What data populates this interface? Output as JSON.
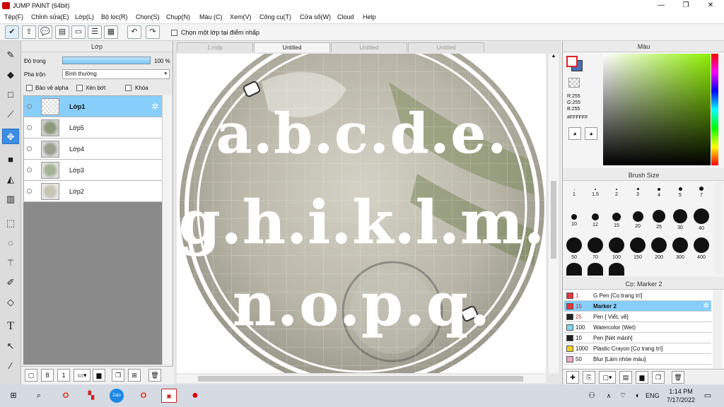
{
  "window": {
    "title": "JUMP PAINT (64bit)"
  },
  "menu": [
    "Tệp(F)",
    "Chỉnh sửa(E)",
    "Lớp(L)",
    "Bộ lọc(R)",
    "Chọn(S)",
    "Chụp(N)",
    "Màu (C)",
    "Xem(V)",
    "Công cụ(T)",
    "Cửa sổ(W)",
    "Cloud",
    "Help"
  ],
  "toolbar": {
    "refer_label": "Chọn một lớp tại điểm nhấp"
  },
  "layer_panel": {
    "title": "Lớp",
    "opacity_label": "Độ trong",
    "opacity_value": "100 %",
    "blend_label": "Pha trộn",
    "blend_value": "Bình thường",
    "alpha_label": "Bảo vệ alpha",
    "clip_label": "Xén bớt",
    "lock_label": "Khóa",
    "layers": [
      {
        "name": "Lớp1"
      },
      {
        "name": "Lớp5"
      },
      {
        "name": "Lớp4"
      },
      {
        "name": "Lớp3"
      },
      {
        "name": "Lớp2"
      }
    ]
  },
  "canvas": {
    "tabs": [
      "1.mdp",
      "Untitled",
      "Untitled",
      "Untitled"
    ],
    "art_lines": [
      "a.b.c.d.e.",
      "g.h.i.k.l.m.",
      "n.o.p.q."
    ]
  },
  "color_panel": {
    "title": "Màu",
    "r": "R:255",
    "g": "G:255",
    "b": "B:255",
    "hex": "#FFFFFF"
  },
  "brush_size": {
    "title": "Brush Size",
    "sizes": [
      "1",
      "1.5",
      "2",
      "3",
      "4",
      "5",
      "7",
      "10",
      "12",
      "15",
      "20",
      "25",
      "30",
      "40",
      "50",
      "70",
      "100",
      "150",
      "200",
      "300",
      "400"
    ]
  },
  "brush_panel": {
    "title": "Cọ: Marker 2",
    "brushes": [
      {
        "size": "1",
        "name": "G Pen [Cọ trang trí]",
        "color": "#e8343b"
      },
      {
        "size": "15",
        "name": "Marker 2",
        "color": "#e8343b"
      },
      {
        "size": "25",
        "name": "Pen [ Viết, vẽ]",
        "color": "#222222"
      },
      {
        "size": "100",
        "name": "Watercolor (Wet)",
        "color": "#7fd8f0"
      },
      {
        "size": "10",
        "name": "Pen [Nét mảnh]",
        "color": "#222222"
      },
      {
        "size": "1000",
        "name": "Plastic Crayon [Cọ trang trí]",
        "color": "#f0d020"
      },
      {
        "size": "50",
        "name": "Blur [Làm nhòe màu]",
        "color": "#f0a8c8"
      }
    ]
  },
  "taskbar": {
    "lang": "ENG",
    "time": "1:14 PM",
    "date": "7/17/2022",
    "zalo": "Zalo"
  }
}
